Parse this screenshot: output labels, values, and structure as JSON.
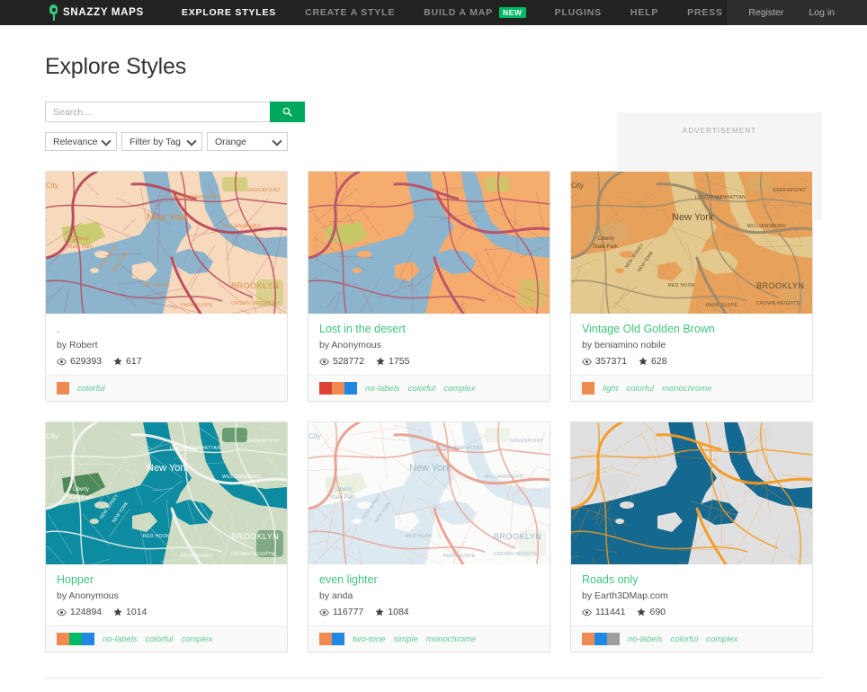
{
  "nav": {
    "brand": "SNAZZY MAPS",
    "brand_icon": "map-pin-icon",
    "items": [
      {
        "label": "EXPLORE STYLES",
        "active": true,
        "badge": null
      },
      {
        "label": "CREATE A STYLE",
        "active": false,
        "badge": null
      },
      {
        "label": "BUILD A MAP",
        "active": false,
        "badge": "NEW"
      },
      {
        "label": "PLUGINS",
        "active": false,
        "badge": null
      },
      {
        "label": "HELP",
        "active": false,
        "badge": null
      },
      {
        "label": "PRESS",
        "active": false,
        "badge": null
      }
    ],
    "register": "Register",
    "login": "Log in"
  },
  "page": {
    "title": "Explore Styles"
  },
  "search": {
    "placeholder": "Search...",
    "value": "",
    "button_icon": "search-icon"
  },
  "filters": [
    {
      "name": "sort",
      "value": "Relevance"
    },
    {
      "name": "tag",
      "value": "Filter by Tag"
    },
    {
      "name": "color",
      "value": "Orange"
    }
  ],
  "advertisement": {
    "label": "ADVERTISEMENT"
  },
  "colors": {
    "accent_green": "#00b964",
    "link_green": "#3cc47c",
    "tag_green": "#5ecb92",
    "nav_bg": "#222222",
    "nav_right_bg": "#2e2e2e"
  },
  "cards": [
    {
      "title": ".",
      "author": "by Robert",
      "views": "629393",
      "favorites": "617",
      "swatches": [
        "#ef8b50"
      ],
      "tags": [
        "colorful"
      ],
      "map": {
        "land": "#f7d9bc",
        "water": "#8cb4cd",
        "road": "#b8495c",
        "park": "#c3ca67",
        "label": "#e08b48",
        "variant": "colorful-warm"
      }
    },
    {
      "title": "Lost in the desert",
      "author": "by Anonymous",
      "views": "528772",
      "favorites": "1755",
      "swatches": [
        "#dd4334",
        "#ef8b50",
        "#1f88e5"
      ],
      "tags": [
        "no-labels",
        "colorful",
        "complex"
      ],
      "map": {
        "land": "#f4ad6e",
        "water": "#8cb4cd",
        "road": "#bb5068",
        "park": "#c3ca67",
        "label": "none",
        "variant": "desert"
      }
    },
    {
      "title": "Vintage Old Golden Brown",
      "author": "by beniamino nobile",
      "views": "357371",
      "favorites": "628",
      "swatches": [
        "#ef8b50"
      ],
      "tags": [
        "light",
        "colorful",
        "monochrome"
      ],
      "map": {
        "land": "#e8a15a",
        "water": "#e3c98d",
        "road": "#9c8a6e",
        "park": "#d9a968",
        "label": "#5e4a2e",
        "variant": "golden"
      }
    },
    {
      "title": "Hopper",
      "author": "by Anonymous",
      "views": "124894",
      "favorites": "1014",
      "swatches": [
        "#ef8b50",
        "#00b964",
        "#1f88e5"
      ],
      "tags": [
        "no-labels",
        "colorful",
        "complex"
      ],
      "map": {
        "land": "#cfdcc4",
        "water": "#0d8ba1",
        "road": "#f5f5f0",
        "park": "#3f7f4f",
        "label": "#ffffff",
        "variant": "hopper"
      }
    },
    {
      "title": "even lighter",
      "author": "by anda",
      "views": "116777",
      "favorites": "1084",
      "swatches": [
        "#ef8b50",
        "#1f88e5"
      ],
      "tags": [
        "two-tone",
        "simple",
        "monochrome"
      ],
      "map": {
        "land": "#fbfbfa",
        "water": "#dce9f0",
        "road": "#e8a091",
        "park": "#e8efe0",
        "label": "#9fb9c9",
        "variant": "even-lighter"
      }
    },
    {
      "title": "Roads only",
      "author": "by Earth3DMap.com",
      "views": "111441",
      "favorites": "690",
      "swatches": [
        "#ef8b50",
        "#1f88e5",
        "#9e9e9e"
      ],
      "tags": [
        "no-labels",
        "colorful",
        "complex"
      ],
      "map": {
        "land": "#e0e0e0",
        "water": "#15688f",
        "road": "#f59a21",
        "park": "#dcdcdc",
        "label": "none",
        "variant": "roads-only"
      }
    }
  ],
  "icons": {
    "views": "eye-icon",
    "favorites": "star-icon"
  }
}
